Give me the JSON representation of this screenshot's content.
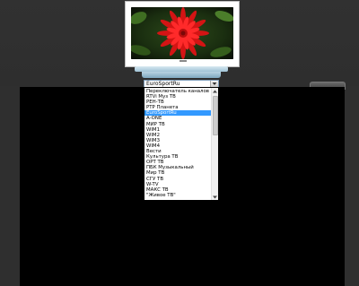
{
  "channel_selector": {
    "selected": "EuroSportRu",
    "options": [
      "Переключатель каналов",
      "RTVi Муз ТВ",
      "РЕН-ТВ",
      "РТР Планета",
      "EuroSportRu",
      "A-ONE",
      "МИР ТВ",
      "WIM1",
      "WIM2",
      "WIM3",
      "WIM4",
      "Вести",
      "Культура ТВ",
      "ОРТ ТВ",
      "ПБК Музыкальный",
      "Мир ТВ",
      "СГУ ТВ",
      "W-TV",
      "МАКС ТВ",
      "\"Живое ТВ\""
    ],
    "highlighted_index": 4
  },
  "colors": {
    "highlight": "#3399ff",
    "player_background": "#000000",
    "page_background": "#2a2a2a"
  },
  "icons": {
    "dropdown_arrow": "chevron-down-icon",
    "scroll_up": "scroll-up-icon",
    "scroll_down": "scroll-down-icon"
  }
}
